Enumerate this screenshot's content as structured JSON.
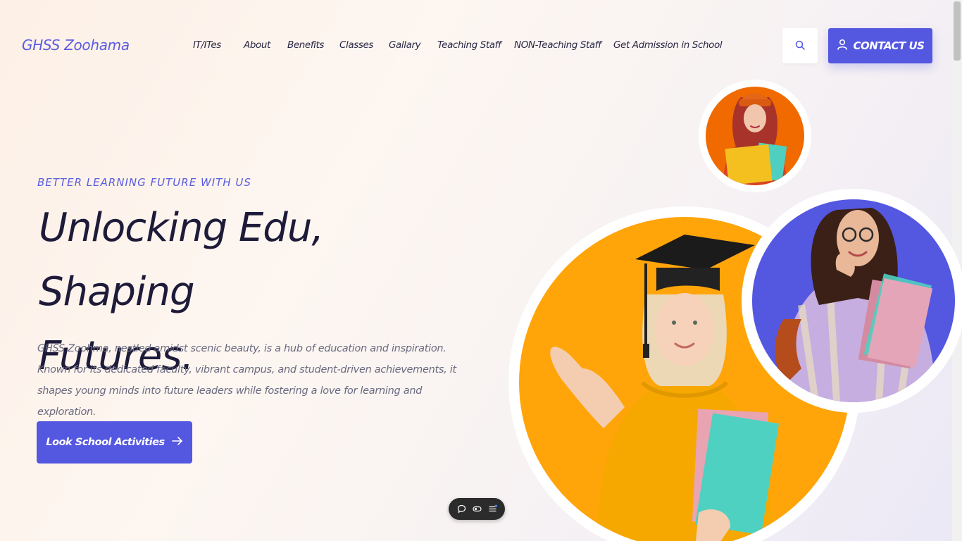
{
  "brand": {
    "logo_text": "GHSS Zoohama"
  },
  "nav": {
    "items": [
      {
        "label": "IT/ITes"
      },
      {
        "label": "About"
      },
      {
        "label": "Benefits"
      },
      {
        "label": "Classes"
      },
      {
        "label": "Gallary"
      },
      {
        "label": "Teaching Staff"
      },
      {
        "label": "NON-Teaching Staff"
      },
      {
        "label": "Get Admission in School"
      }
    ],
    "search_icon": "search-icon",
    "contact_label": "CONTACT US",
    "contact_icon": "user-icon"
  },
  "hero": {
    "eyebrow": "BETTER LEARNING FUTURE WITH US",
    "title_line1": "Unlocking Edu, Shaping",
    "title_line2": "Futures.",
    "description": "GHSS Zoohma, nestled amidst scenic beauty, is a hub of education and inspiration. Known for its dedicated faculty, vibrant campus, and student-driven achievements, it shapes young minds into future leaders while fostering a love for learning and exploration.",
    "cta_label": "Look School Activities",
    "cta_icon": "arrow-right-icon"
  },
  "images": {
    "main": "student-graduate-photo",
    "right": "student-with-glasses-photo",
    "small": "student-with-books-photo"
  },
  "widget": {
    "icons": [
      "chat-icon",
      "toggle-icon",
      "menu-icon"
    ]
  },
  "colors": {
    "accent": "#5457e0",
    "heading": "#1e1b3a",
    "text": "#6a6a80",
    "orange": "#ffa50a",
    "dark_orange": "#f06a00"
  }
}
